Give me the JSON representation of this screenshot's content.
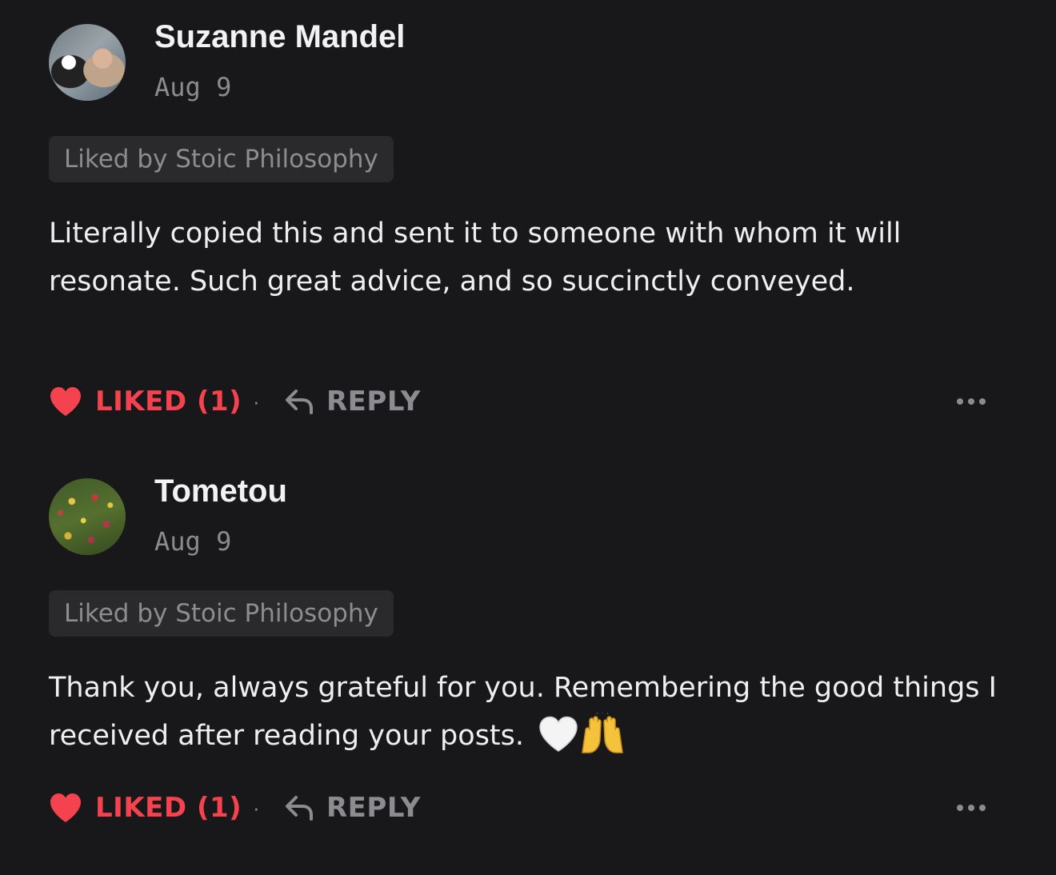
{
  "comments": [
    {
      "author": "Suzanne Mandel",
      "date": "Aug 9",
      "liked_by": "Liked by Stoic Philosophy",
      "text": "Literally copied this and sent it to someone with whom it will resonate. Such great advice, and so succinctly conveyed.",
      "like_label": "LIKED (1)",
      "separator": "·",
      "reply_label": "REPLY"
    },
    {
      "author": "Tometou",
      "date": "Aug 9",
      "liked_by": "Liked by Stoic Philosophy",
      "text": "Thank you, always grateful for you. Remembering the good things I received after reading your posts.",
      "like_label": "LIKED (1)",
      "separator": "·",
      "reply_label": "REPLY"
    }
  ],
  "colors": {
    "background": "#18181a",
    "liked_red": "#f4424f",
    "muted_text": "#8c8c90",
    "badge_bg": "#2a2a2d"
  },
  "icons": {
    "like": "heart-icon",
    "reply": "reply-arrow-icon",
    "more": "ellipsis-icon",
    "emoji_1": "white-heart-emoji",
    "emoji_2": "raised-hands-emoji"
  }
}
